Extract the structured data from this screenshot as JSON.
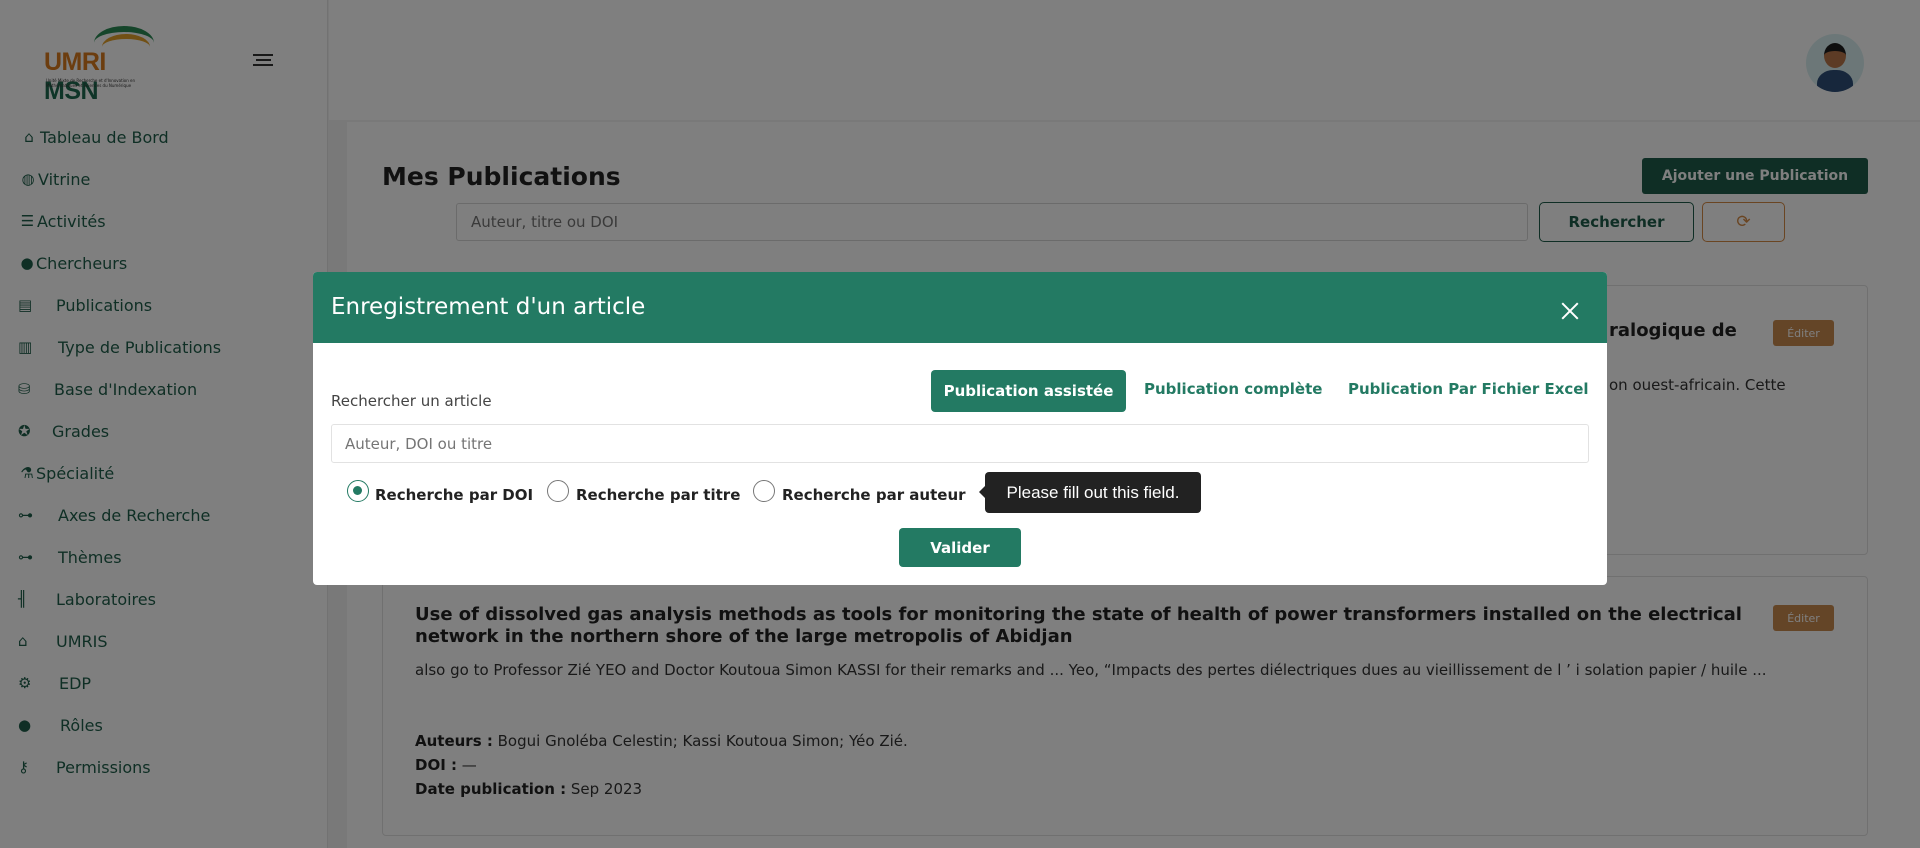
{
  "logo": {
    "line1": "UMRI",
    "line2": "MSN",
    "subtitle": "Unité Mixte de Recherche et d'Innovation en Mathématiques et Sciences du Numérique"
  },
  "sidebar": {
    "items": [
      {
        "label": "Tableau de Bord",
        "icon": "home-icon"
      },
      {
        "label": "Vitrine",
        "icon": "globe-icon"
      },
      {
        "label": "Activités",
        "icon": "list-check-icon"
      },
      {
        "label": "Chercheurs",
        "icon": "user-icon"
      },
      {
        "label": "Publications",
        "icon": "newspaper-icon"
      },
      {
        "label": "Type de Publications",
        "icon": "book-open-icon"
      },
      {
        "label": "Base d'Indexation",
        "icon": "database-icon"
      },
      {
        "label": "Grades",
        "icon": "award-icon"
      },
      {
        "label": "Spécialité",
        "icon": "flask-icon"
      },
      {
        "label": "Axes de Recherche",
        "icon": "diagram-icon"
      },
      {
        "label": "Thèmes",
        "icon": "diagram-icon"
      },
      {
        "label": "Laboratoires",
        "icon": "utensils-icon"
      },
      {
        "label": "UMRIS",
        "icon": "bank-icon"
      },
      {
        "label": "EDP",
        "icon": "users-cog-icon"
      },
      {
        "label": "Rôles",
        "icon": "user-lock-icon"
      },
      {
        "label": "Permissions",
        "icon": "key-icon"
      }
    ]
  },
  "main": {
    "title": "Mes Publications",
    "add_button": "Ajouter une Publication",
    "search_placeholder": "Auteur, titre ou DOI",
    "search_button": "Rechercher",
    "publications": [
      {
        "title_tail": "ralogique de",
        "text_tail": "on ouest-africain. Cette",
        "edit": "Éditer"
      },
      {
        "title": "Use of dissolved gas analysis methods as tools for monitoring the state of health of power transformers installed on the electrical network in the northern shore of the large metropolis of Abidjan",
        "excerpt": "also go to Professor Zié YEO and Doctor Koutoua Simon KASSI for their remarks and ... Yeo, “Impacts des pertes diélectriques dues au vieillissement de l ’ i solation papier / huile ...",
        "authors_label": "Auteurs :",
        "authors": "Bogui Gnoléba Celestin; Kassi Koutoua Simon; Yéo Zié.",
        "doi_label": "DOI :",
        "doi": "—",
        "date_label": "Date publication :",
        "date": "Sep 2023",
        "edit": "Éditer"
      }
    ]
  },
  "modal": {
    "title": "Enregistrement d'un article",
    "search_label": "Rechercher un article",
    "tabs": [
      "Publication assistée",
      "Publication complète",
      "Publication Par Fichier Excel"
    ],
    "input_placeholder": "Auteur, DOI ou titre",
    "radios": [
      {
        "label": "Recherche par DOI",
        "checked": true
      },
      {
        "label": "Recherche par titre",
        "checked": false
      },
      {
        "label": "Recherche par auteur",
        "checked": false
      }
    ],
    "tooltip": "Please fill out this field.",
    "submit": "Valider"
  },
  "colors": {
    "primary": "#237a63",
    "primary_dark": "#1e5d4a",
    "accent": "#c98a4e"
  }
}
